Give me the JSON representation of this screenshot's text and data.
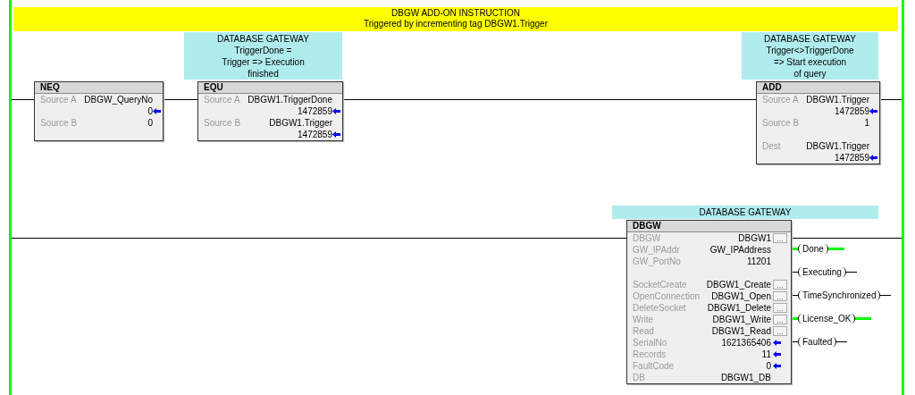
{
  "rungs": [
    {
      "banner": {
        "lines": [
          "DBGW ADD-ON INSTRUCTION",
          "Triggered by incrementing tag DBGW1.Trigger"
        ]
      },
      "comments": [
        {
          "lines": [
            "DATABASE GATEWAY",
            "TriggerDone =",
            "Trigger => Execution",
            "finished"
          ]
        },
        {
          "lines": [
            "DATABASE GATEWAY",
            "Trigger<>TriggerDone",
            "=> Start execution",
            "of query"
          ]
        }
      ],
      "instructions": [
        {
          "mnemonic": "NEQ",
          "params": [
            {
              "kind": "tag_value",
              "label": "Source A",
              "tag": "DBGW_QueryNo",
              "value": "0"
            },
            {
              "kind": "constant",
              "label": "Source B",
              "value": "0"
            }
          ]
        },
        {
          "mnemonic": "EQU",
          "params": [
            {
              "kind": "tag_value",
              "label": "Source A",
              "tag": "DBGW1.TriggerDone",
              "value": "1472859"
            },
            {
              "kind": "tag_value",
              "label": "Source B",
              "tag": "DBGW1.Trigger",
              "value": "1472859"
            }
          ]
        },
        {
          "mnemonic": "ADD",
          "params": [
            {
              "kind": "tag_value",
              "label": "Source A",
              "tag": "DBGW1.Trigger",
              "value": "1472859"
            },
            {
              "kind": "constant",
              "label": "Source B",
              "value": "1"
            },
            {
              "kind": "tag_value",
              "label": "Dest",
              "tag": "DBGW1.Trigger",
              "value": "1472859"
            }
          ]
        }
      ]
    },
    {
      "comments": [
        {
          "lines": [
            "DATABASE GATEWAY"
          ]
        }
      ],
      "instructions": [
        {
          "mnemonic": "DBGW",
          "params": [
            {
              "kind": "tag",
              "label": "DBGW",
              "tag": "DBGW1",
              "button": "..."
            },
            {
              "kind": "tag",
              "label": "GW_IPAddr",
              "tag": "GW_IPAddress"
            },
            {
              "kind": "constant",
              "label": "GW_PortNo",
              "value": "11201"
            },
            {
              "kind": "tag",
              "label": "SocketCreate",
              "tag": "DBGW1_Create",
              "button": "..."
            },
            {
              "kind": "tag",
              "label": "OpenConnection",
              "tag": "DBGW1_Open",
              "button": "..."
            },
            {
              "kind": "tag",
              "label": "DeleteSocket",
              "tag": "DBGW1_Delete",
              "button": "..."
            },
            {
              "kind": "tag",
              "label": "Write",
              "tag": "DBGW1_Write",
              "button": "..."
            },
            {
              "kind": "tag",
              "label": "Read",
              "tag": "DBGW1_Read",
              "button": "..."
            },
            {
              "kind": "value",
              "label": "SerialNo",
              "value": "1621365406"
            },
            {
              "kind": "value",
              "label": "Records",
              "value": "11"
            },
            {
              "kind": "value",
              "label": "FaultCode",
              "value": "0"
            },
            {
              "kind": "tag",
              "label": "DB",
              "tag": "DBGW1_DB"
            }
          ]
        }
      ],
      "outputs": [
        {
          "label": "Done",
          "energized": true
        },
        {
          "label": "Executing",
          "energized": false
        },
        {
          "label": "TimeSynchronized",
          "energized": false
        },
        {
          "label": "License_OK",
          "energized": true
        },
        {
          "label": "Faulted",
          "energized": false
        }
      ]
    }
  ]
}
